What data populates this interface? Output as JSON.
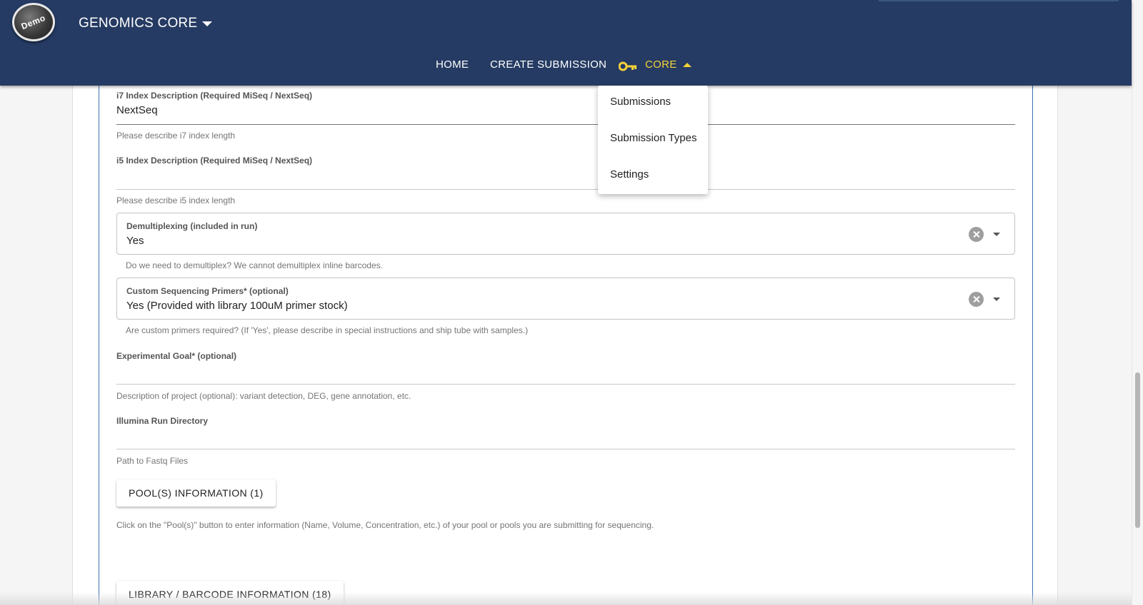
{
  "header": {
    "logo_text": "Demo",
    "app_title": "GENOMICS CORE",
    "nav": {
      "home": "HOME",
      "create_submission": "CREATE SUBMISSION",
      "core": "CORE"
    },
    "accent_color": "#f7d23a",
    "bar_color": "#253b63"
  },
  "core_menu": {
    "items": [
      "Submissions",
      "Submission Types",
      "Settings"
    ]
  },
  "form": {
    "i7": {
      "label": "i7 Index Description (Required MiSeq / NextSeq)",
      "value": "NextSeq",
      "hint": "Please describe i7 index length"
    },
    "i5": {
      "label": "i5 Index Description (Required MiSeq / NextSeq)",
      "value": "",
      "hint": "Please describe i5 index length"
    },
    "demultiplexing": {
      "label": "Demultiplexing (included in run)",
      "value": "Yes",
      "hint": "Do we need to demultiplex? We cannot demultiplex inline barcodes."
    },
    "custom_primers": {
      "label": "Custom Sequencing Primers* (optional)",
      "value": "Yes (Provided with library 100uM primer stock)",
      "hint": "Are custom primers required? (If 'Yes', please describe in special instructions and ship tube with samples.)"
    },
    "experimental_goal": {
      "label": "Experimental Goal* (optional)",
      "value": "",
      "hint": "Description of project (optional): variant detection, DEG, gene annotation, etc."
    },
    "run_directory": {
      "label": "Illumina Run Directory",
      "value": "",
      "hint": "Path to Fastq Files"
    },
    "pools_button": "POOL(S) INFORMATION (1)",
    "pools_hint": "Click on the \"Pool(s)\" button to enter information (Name, Volume, Concentration, etc.) of your pool or pools you are submitting for sequencing.",
    "library_button": "LIBRARY / BARCODE INFORMATION (18)"
  }
}
